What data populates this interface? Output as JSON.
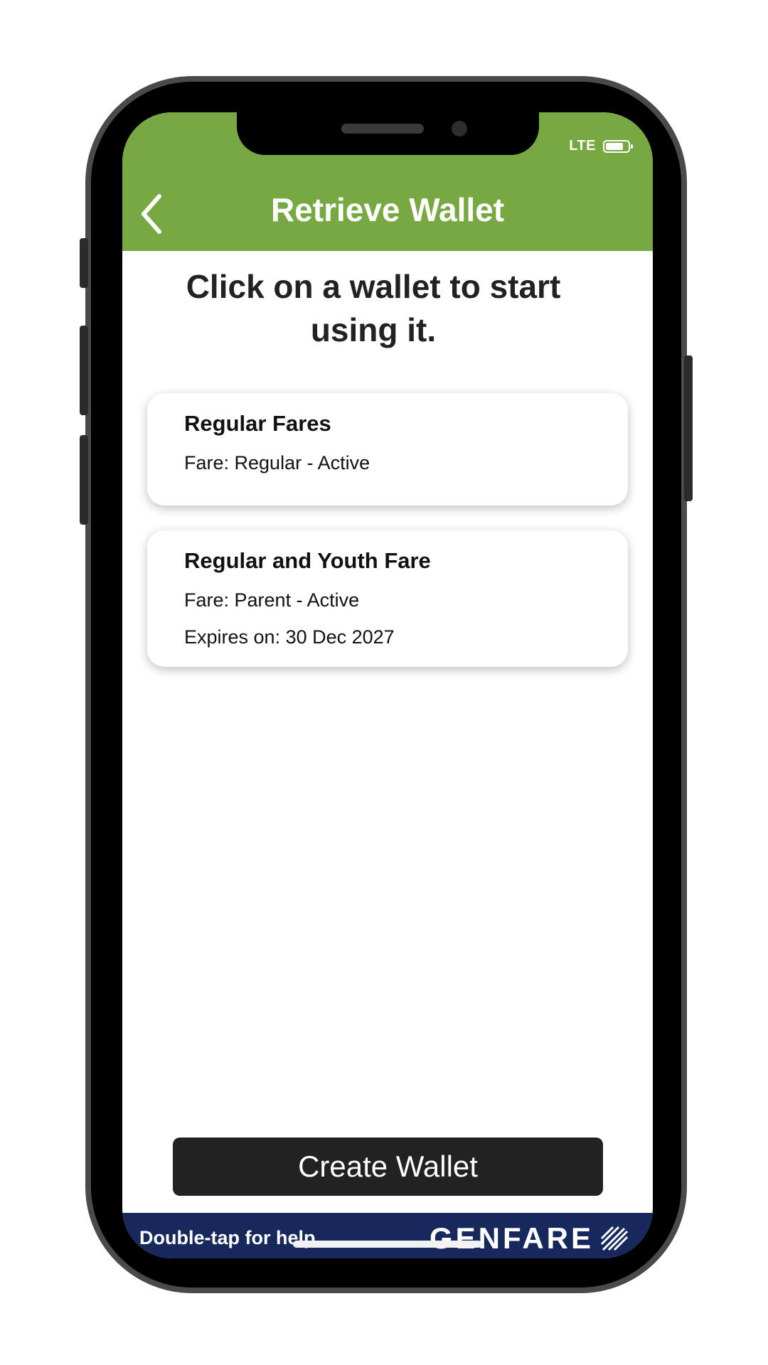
{
  "status": {
    "network": "LTE"
  },
  "header": {
    "title": "Retrieve Wallet"
  },
  "main": {
    "instruction": "Click on a wallet to start using it.",
    "wallets": [
      {
        "name": "Regular Fares",
        "fare": "Fare: Regular - Active"
      },
      {
        "name": "Regular and Youth Fare",
        "fare": "Fare: Parent - Active",
        "expires": "Expires on: 30 Dec 2027"
      }
    ],
    "create_button": "Create Wallet"
  },
  "footer": {
    "help_text": "Double-tap for help",
    "brand": "GENFARE"
  },
  "colors": {
    "header": "#78a842",
    "footer": "#17295c",
    "button": "#222222"
  }
}
